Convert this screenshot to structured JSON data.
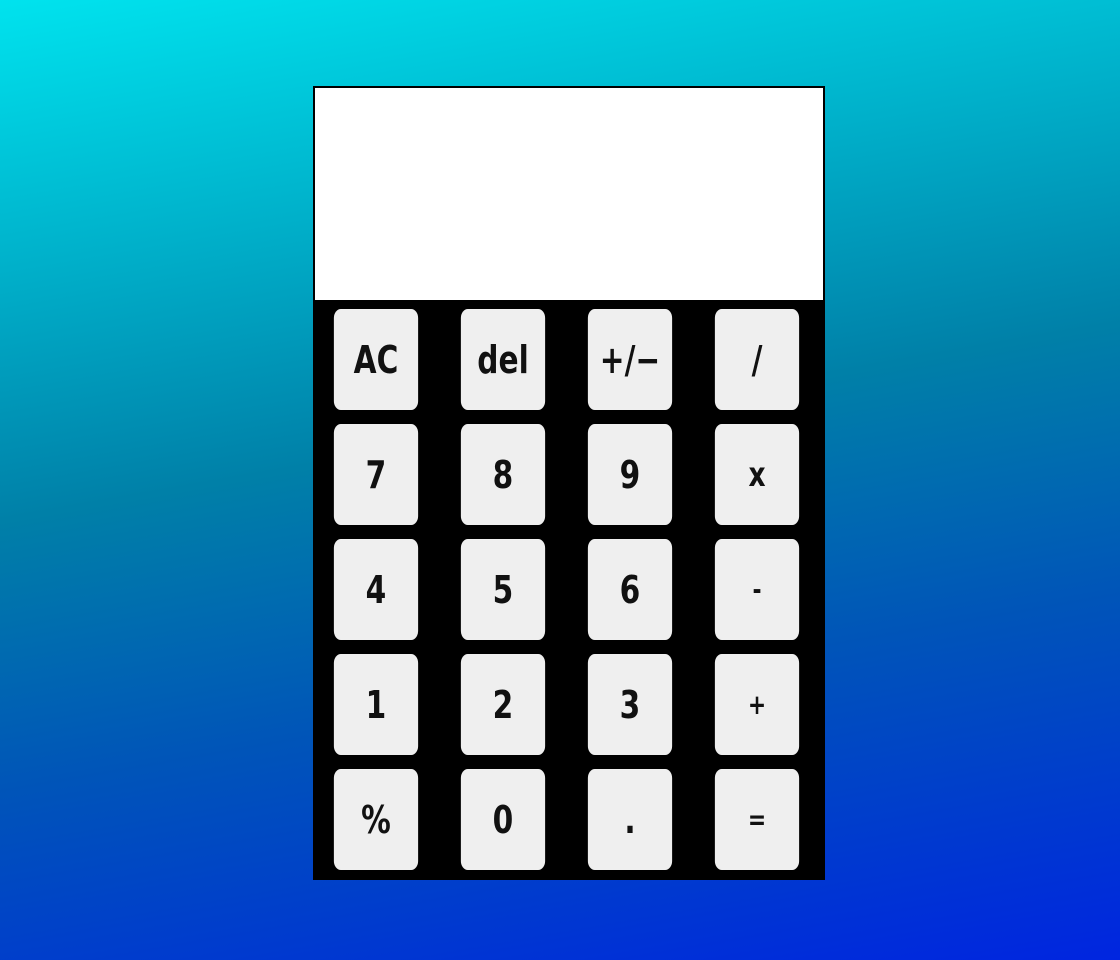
{
  "display": {
    "value": ""
  },
  "keys": [
    {
      "label": "AC",
      "name": "clear-button"
    },
    {
      "label": "del",
      "name": "delete-button"
    },
    {
      "label": "+/−",
      "name": "toggle-sign-button"
    },
    {
      "label": "/",
      "name": "divide-button"
    },
    {
      "label": "7",
      "name": "digit-7-button"
    },
    {
      "label": "8",
      "name": "digit-8-button"
    },
    {
      "label": "9",
      "name": "digit-9-button"
    },
    {
      "label": "x",
      "name": "multiply-button"
    },
    {
      "label": "4",
      "name": "digit-4-button"
    },
    {
      "label": "5",
      "name": "digit-5-button"
    },
    {
      "label": "6",
      "name": "digit-6-button"
    },
    {
      "label": "-",
      "name": "subtract-button"
    },
    {
      "label": "1",
      "name": "digit-1-button"
    },
    {
      "label": "2",
      "name": "digit-2-button"
    },
    {
      "label": "3",
      "name": "digit-3-button"
    },
    {
      "label": "+",
      "name": "add-button"
    },
    {
      "label": "%",
      "name": "percent-button"
    },
    {
      "label": "0",
      "name": "digit-0-button"
    },
    {
      "label": ".",
      "name": "decimal-button"
    },
    {
      "label": "=",
      "name": "equals-button"
    }
  ],
  "colors": {
    "key_background": "#efefef",
    "frame": "#000000",
    "display_background": "#ffffff"
  }
}
